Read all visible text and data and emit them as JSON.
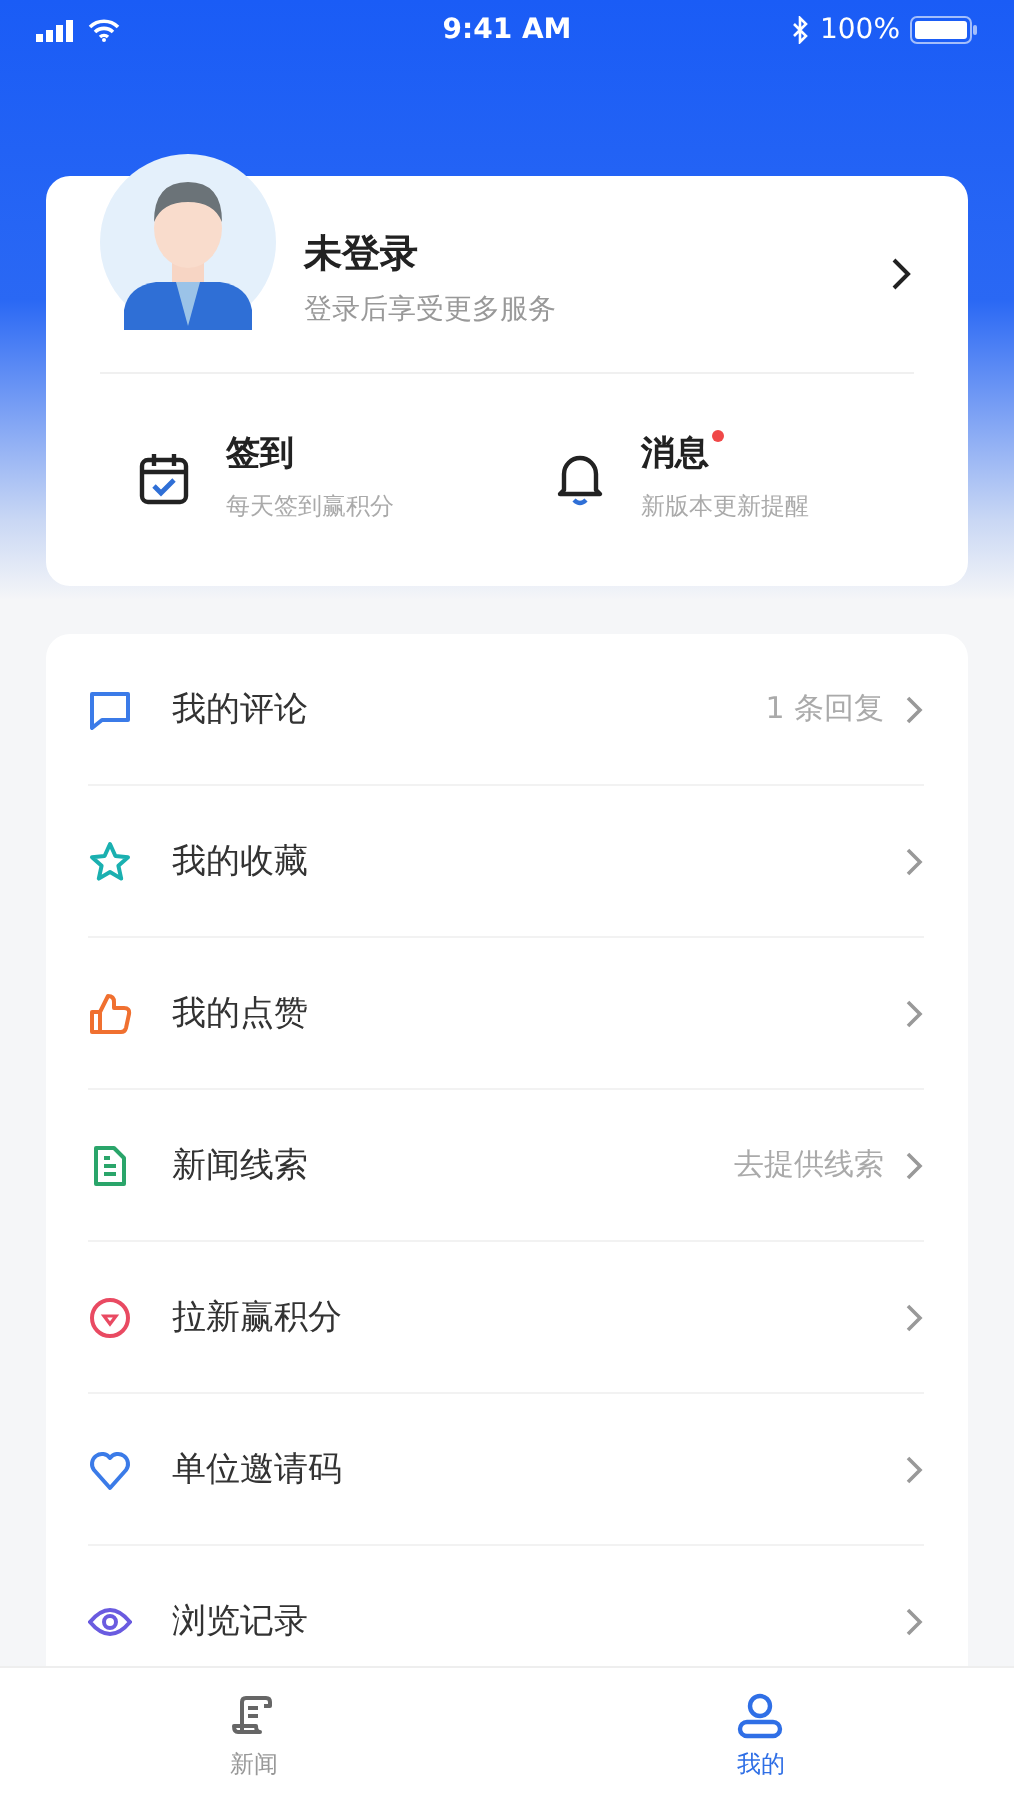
{
  "status_bar": {
    "time": "9:41 AM",
    "battery": "100%"
  },
  "profile": {
    "name": "未登录",
    "subtitle": "登录后享受更多服务"
  },
  "shortcuts": [
    {
      "kind": "calendar",
      "title": "签到",
      "subtitle": "每天签到赢积分",
      "badge": false
    },
    {
      "kind": "bell",
      "title": "消息",
      "subtitle": "新版本更新提醒",
      "badge": true
    }
  ],
  "menu": [
    {
      "kind": "comment",
      "label": "我的评论",
      "detail": "1 条回复"
    },
    {
      "kind": "star",
      "label": "我的收藏"
    },
    {
      "kind": "thumb",
      "label": "我的点赞"
    },
    {
      "kind": "document",
      "label": "新闻线索",
      "detail": "去提供线索"
    },
    {
      "kind": "target",
      "label": "拉新赢积分"
    },
    {
      "kind": "heart",
      "label": "单位邀请码"
    },
    {
      "kind": "eye",
      "label": "浏览记录"
    }
  ],
  "tab_bar": [
    {
      "kind": "news",
      "label": "新闻",
      "selected": false
    },
    {
      "kind": "person",
      "label": "我的",
      "selected": true
    }
  ]
}
